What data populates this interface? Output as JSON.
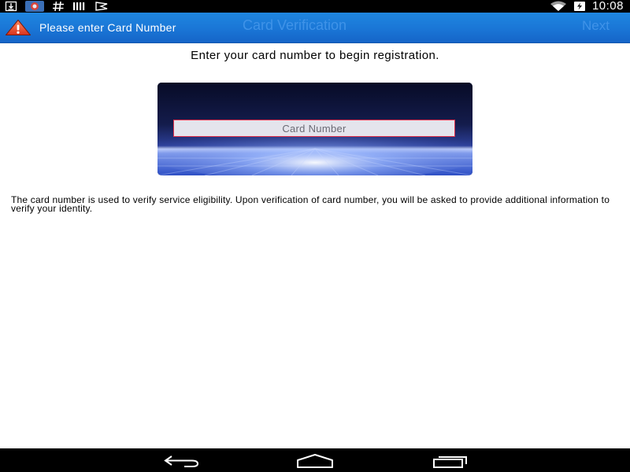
{
  "status_bar": {
    "time": "10:08",
    "left_icons": [
      "download-icon",
      "photos-icon",
      "hashtag-icon",
      "signal-bars-icon",
      "mail-flag-icon"
    ],
    "right_icons": [
      "wifi-icon",
      "battery-charging-icon"
    ]
  },
  "header": {
    "title": "Card Verification",
    "next_label": "Next",
    "alert_message": "Please enter Card Number",
    "alert_icon": "warning-icon",
    "colors": {
      "bar": "#1a76d6",
      "faded_text": "#3f93e8"
    }
  },
  "main": {
    "instruction": "Enter your card number to begin registration.",
    "card_input": {
      "placeholder": "Card Number",
      "value": ""
    },
    "info_text": "The card number is used to verify service eligibility. Upon verification of card number, you will be asked to provide additional information to verify your identity."
  },
  "nav_bar": {
    "buttons": [
      "back-icon",
      "home-icon",
      "recent-apps-icon"
    ]
  }
}
